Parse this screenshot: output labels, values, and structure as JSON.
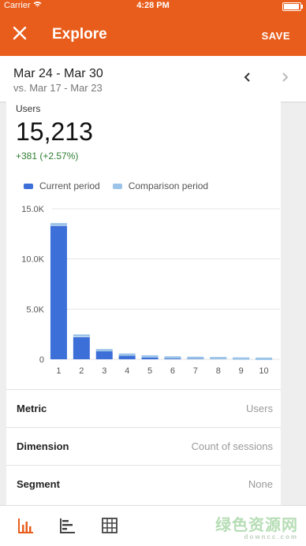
{
  "status_bar": {
    "carrier": "Carrier",
    "time": "4:28 PM",
    "battery_level": 0.95
  },
  "app_bar": {
    "close_icon": "close-icon",
    "title": "Explore",
    "save_label": "SAVE"
  },
  "date_bar": {
    "range": "Mar 24 - Mar 30",
    "compare": "vs. Mar 17 - Mar 23",
    "prev_icon": "chevron-left-icon",
    "next_icon": "chevron-right-icon"
  },
  "card": {
    "metric_name": "Users",
    "metric_value": "15,213",
    "delta": "+381 (+2.57%)"
  },
  "legend": {
    "current": "Current period",
    "comparison": "Comparison period"
  },
  "colors": {
    "brand": "#e85d1c",
    "current": "#3d6fd8",
    "comparison": "#9cc3e8",
    "delta": "#2e7d32"
  },
  "chart_data": {
    "type": "bar",
    "categories": [
      "1",
      "2",
      "3",
      "4",
      "5",
      "6",
      "7",
      "8",
      "9",
      "10"
    ],
    "series": [
      {
        "name": "Current period",
        "values": [
          13300,
          2200,
          800,
          400,
          200,
          150,
          120,
          100,
          80,
          60
        ]
      },
      {
        "name": "Comparison period",
        "values": [
          13500,
          2400,
          950,
          500,
          320,
          220,
          180,
          150,
          110,
          90
        ]
      }
    ],
    "y_ticks": [
      "15.0K",
      "10.0K",
      "5.0K",
      "0"
    ],
    "ylim": [
      0,
      15000
    ],
    "grid": true,
    "legend_position": "top-left"
  },
  "rows": [
    {
      "label": "Metric",
      "value": "Users"
    },
    {
      "label": "Dimension",
      "value": "Count of sessions"
    },
    {
      "label": "Segment",
      "value": "None"
    }
  ],
  "bottom_bar": {
    "icons": [
      "bar-chart-icon",
      "horizontal-bar-icon",
      "table-icon"
    ]
  },
  "watermark": {
    "text": "绿色资源网",
    "sub": "downcc.com"
  }
}
